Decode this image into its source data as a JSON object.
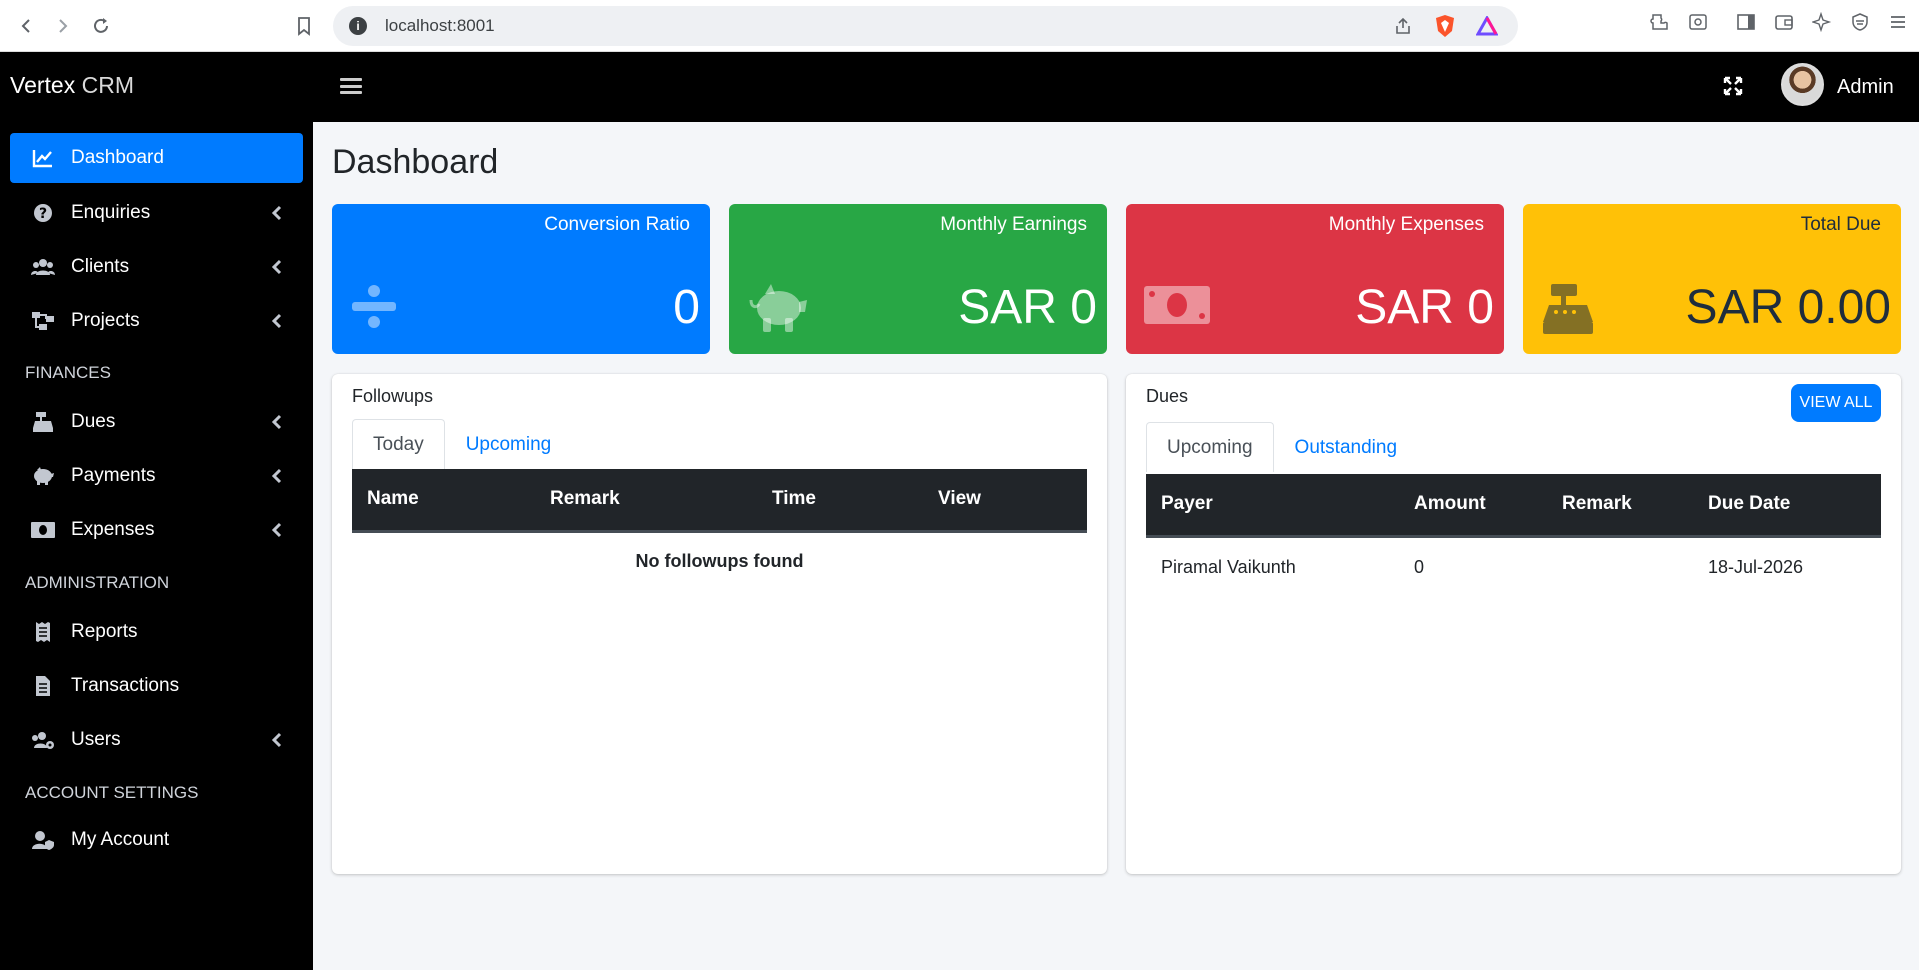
{
  "browser": {
    "url": "localhost:8001"
  },
  "topbar": {
    "brand_bold": "Vertex",
    "brand_light": " CRM",
    "user_name": "Admin"
  },
  "sidebar": {
    "items": [
      {
        "label": "Dashboard"
      },
      {
        "label": "Enquiries"
      },
      {
        "label": "Clients"
      },
      {
        "label": "Projects"
      },
      {
        "label": "Dues"
      },
      {
        "label": "Payments"
      },
      {
        "label": "Expenses"
      },
      {
        "label": "Reports"
      },
      {
        "label": "Transactions"
      },
      {
        "label": "Users"
      },
      {
        "label": "My Account"
      }
    ],
    "headers": {
      "finances": "FINANCES",
      "administration": "ADMINISTRATION",
      "account_settings": "ACCOUNT SETTINGS"
    }
  },
  "main": {
    "title": "Dashboard",
    "boxes": [
      {
        "label": "Conversion Ratio",
        "value": "0",
        "icon": "divide-icon",
        "color": "#007bff"
      },
      {
        "label": "Monthly Earnings",
        "value": "SAR 0",
        "icon": "piggy-bank-icon",
        "color": "#28a745"
      },
      {
        "label": "Monthly Expenses",
        "value": "SAR 0",
        "icon": "money-bill-icon",
        "color": "#dc3545"
      },
      {
        "label": "Total Due",
        "value": "SAR 0.00",
        "icon": "cash-register-icon",
        "color": "#ffc107"
      }
    ],
    "followups": {
      "title": "Followups",
      "tabs": [
        "Today",
        "Upcoming"
      ],
      "columns": [
        "Name",
        "Remark",
        "Time",
        "View"
      ],
      "empty_text": "No followups found"
    },
    "dues": {
      "title": "Dues",
      "view_all": "VIEW ALL",
      "tabs": [
        "Upcoming",
        "Outstanding"
      ],
      "columns": [
        "Payer",
        "Amount",
        "Remark",
        "Due Date"
      ],
      "rows": [
        [
          "Piramal Vaikunth",
          "0",
          "",
          "18-Jul-2026"
        ]
      ]
    }
  }
}
